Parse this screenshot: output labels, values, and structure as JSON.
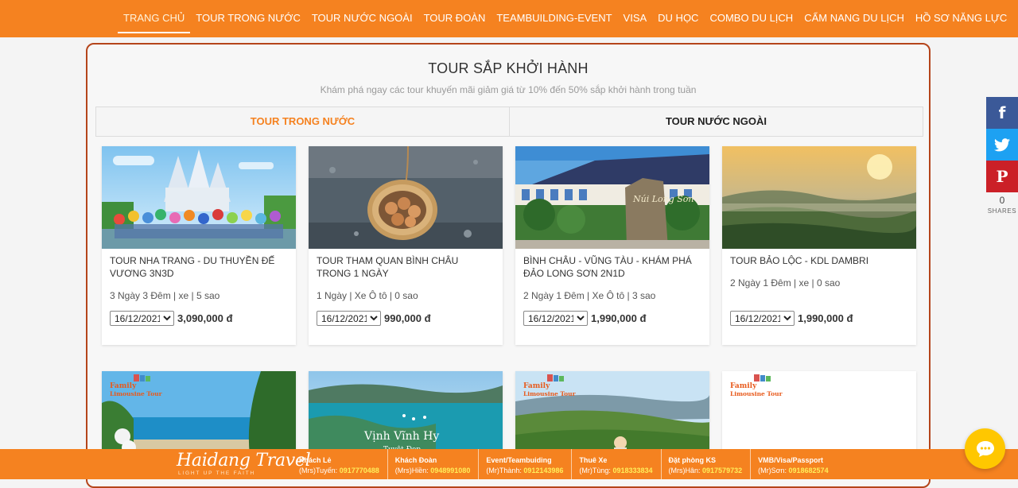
{
  "nav": {
    "items": [
      {
        "label": "TRANG CHỦ",
        "active": true
      },
      {
        "label": "TOUR TRONG NƯỚC"
      },
      {
        "label": "TOUR NƯỚC NGOÀI"
      },
      {
        "label": "TOUR ĐOÀN"
      },
      {
        "label": "TEAMBUILDING-EVENT"
      },
      {
        "label": "VISA"
      },
      {
        "label": "DU HỌC"
      },
      {
        "label": "COMBO DU LỊCH"
      },
      {
        "label": "CẨM NANG DU LỊCH"
      },
      {
        "label": "HỒ SƠ NĂNG LỰC"
      }
    ]
  },
  "section": {
    "title": "TOUR SẮP KHỞI HÀNH",
    "subtitle": "Khám phá ngay các tour khuyến mãi giảm giá từ 10% đến 50% sắp khởi hành trong tuần",
    "tabs": [
      {
        "label": "TOUR TRONG NƯỚC",
        "active": true
      },
      {
        "label": "TOUR NƯỚC NGOÀI"
      }
    ]
  },
  "tours": [
    {
      "name": "TOUR NHA TRANG - DU THUYỀN ĐẾ VƯƠNG 3N3D",
      "meta": "3 Ngày 3 Đêm | xe | 5 sao",
      "date": "16/12/2021",
      "price": "3,090,000 đ"
    },
    {
      "name": "TOUR THAM QUAN BÌNH CHÂU TRONG 1 NGÀY",
      "meta": "1 Ngày | Xe Ô tô | 0 sao",
      "date": "16/12/2021",
      "price": "990,000 đ"
    },
    {
      "name": "BÌNH CHÂU - VŨNG TÀU - KHÁM PHÁ ĐẢO LONG SƠN 2N1D",
      "meta": "2 Ngày 1 Đêm | Xe Ô tô | 3 sao",
      "date": "16/12/2021",
      "price": "1,990,000 đ"
    },
    {
      "name": "TOUR BẢO LỘC - KDL DAMBRI",
      "meta": "2 Ngày 1 Đêm | xe | 0 sao",
      "date": "16/12/2021",
      "price": "1,990,000 đ"
    }
  ],
  "image_texts": {
    "logo_top": "Family",
    "logo_bottom": "Limousine Tour",
    "vinh_vinh_hy": "Vịnh Vĩnh Hy",
    "vinh_vinh_hy_sub": "Tuyệt Đẹp",
    "stone_text": "Núi Long Sơn"
  },
  "share": {
    "count": "0",
    "label": "SHARES"
  },
  "footer": {
    "brand": "Haidang Travel",
    "tagline": "LIGHT UP THE FAITH",
    "contacts": [
      {
        "heading": "Khách Lẻ",
        "person": "(Mrs)Tuyến:",
        "phone": "0917770488"
      },
      {
        "heading": "Khách Đoàn",
        "person": "(Mrs)Hiền:",
        "phone": "0948991080"
      },
      {
        "heading": "Event/Teambuiding",
        "person": "(Mr)Thành:",
        "phone": "0912143986"
      },
      {
        "heading": "Thuê Xe",
        "person": "(Mr)Tùng:",
        "phone": "0918333834"
      },
      {
        "heading": "Đặt phòng KS",
        "person": "(Mrs)Hân:",
        "phone": "0917579732"
      },
      {
        "heading": "VMB/Visa/Passport",
        "person": "(Mr)Sơn:",
        "phone": "0918682574"
      }
    ]
  },
  "colors": {
    "brand_orange": "#f58220",
    "panel_border": "#b5451b",
    "facebook": "#3b5998",
    "twitter": "#1da1f2",
    "pinterest": "#cb2027",
    "chat_yellow": "#ffc700"
  }
}
